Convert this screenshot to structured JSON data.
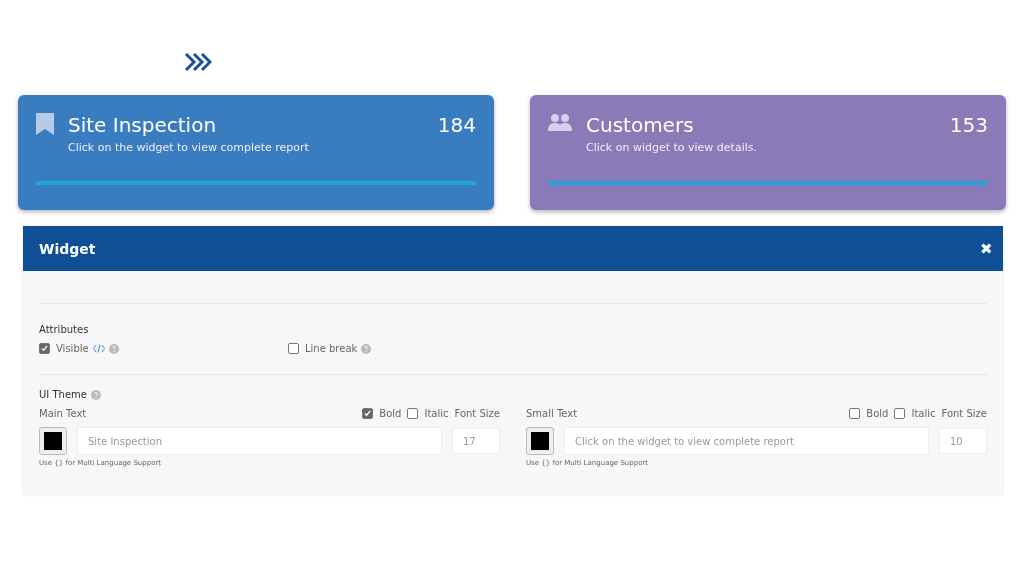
{
  "cards": [
    {
      "kind": "bookmark",
      "title": "Site Inspection",
      "subtitle": "Click on the widget to view complete report",
      "count": "184",
      "color": "#3a7cc0"
    },
    {
      "kind": "people",
      "title": "Customers",
      "subtitle": "Click on widget to view details.",
      "count": "153",
      "color": "#8a7ab8"
    }
  ],
  "panel": {
    "title": "Widget",
    "close": "✖",
    "attributes": {
      "heading": "Attributes",
      "visible": {
        "label": "Visible",
        "checked": true
      },
      "line_break": {
        "label": "Line break",
        "checked": false
      }
    },
    "ui_theme": {
      "heading": "UI Theme",
      "texts": [
        {
          "label": "Main Text",
          "bold": {
            "label": "Bold",
            "checked": true
          },
          "italic": {
            "label": "Italic",
            "checked": false
          },
          "font_size_label": "Font Size",
          "color": "#000000",
          "value": "Site Inspection",
          "font_size": "17",
          "hint": "Use {} for Multi Language Support"
        },
        {
          "label": "Small Text",
          "bold": {
            "label": "Bold",
            "checked": false
          },
          "italic": {
            "label": "Italic",
            "checked": false
          },
          "font_size_label": "Font Size",
          "color": "#000000",
          "value": "Click on the widget to view complete report",
          "font_size": "10",
          "hint": "Use {} for Multi Language Support"
        }
      ]
    }
  }
}
